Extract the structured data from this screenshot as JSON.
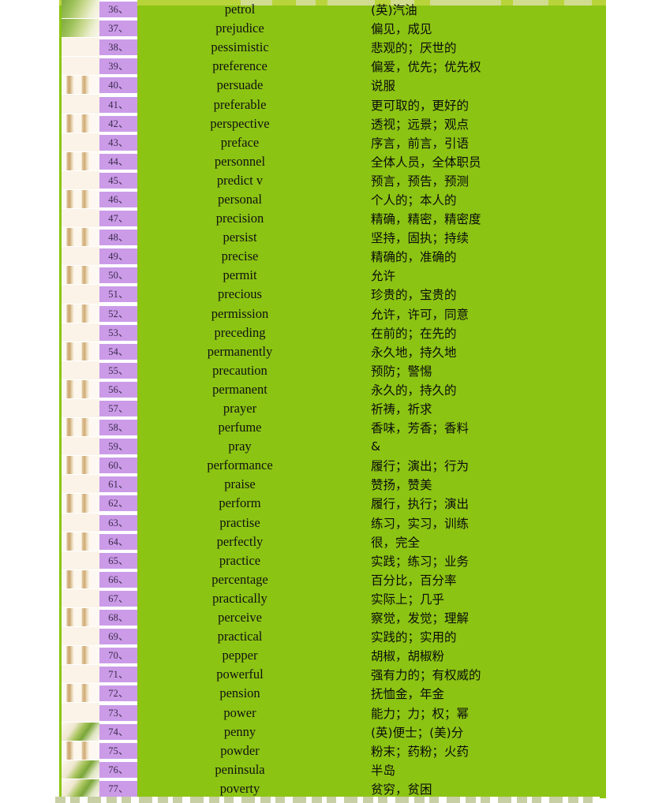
{
  "page": {
    "background_color": "#ffffff",
    "panel_color": "#8cc413",
    "badge_color": "#cb9be8",
    "top_strip_color": "#b9d43a"
  },
  "columns": {
    "index_header": "",
    "word_header": "",
    "translation_header": ""
  },
  "rows": [
    {
      "num": "36、",
      "word": "petrol",
      "trans": "(英)汽油",
      "photo": "leafy"
    },
    {
      "num": "37、",
      "word": "prejudice",
      "trans": "偏见，成见",
      "photo": "leafy"
    },
    {
      "num": "38、",
      "word": "pessimistic",
      "trans": "悲观的；厌世的",
      "photo": "stalk"
    },
    {
      "num": "39、",
      "word": "preference",
      "trans": "偏爱，优先；优先权",
      "photo": "stalk"
    },
    {
      "num": "40、",
      "word": "persuade",
      "trans": "说服",
      "photo": "stalk2"
    },
    {
      "num": "41、",
      "word": "preferable",
      "trans": "更可取的，更好的",
      "photo": "stalk"
    },
    {
      "num": "42、",
      "word": "perspective",
      "trans": "透视；远景；观点",
      "photo": "stalk2"
    },
    {
      "num": "43、",
      "word": "preface",
      "trans": "序言，前言，引语",
      "photo": "stalk"
    },
    {
      "num": "44、",
      "word": "personnel",
      "trans": "全体人员，全体职员",
      "photo": "stalk2"
    },
    {
      "num": "45、",
      "word": "predict v",
      "trans": "预言，预告，预测",
      "photo": "stalk"
    },
    {
      "num": "46、",
      "word": "personal",
      "trans": "个人的；本人的",
      "photo": "stalk2"
    },
    {
      "num": "47、",
      "word": "precision",
      "trans": "精确，精密，精密度",
      "photo": "stalk"
    },
    {
      "num": "48、",
      "word": "persist",
      "trans": "坚持，固执；持续",
      "photo": "stalk2"
    },
    {
      "num": "49、",
      "word": "precise",
      "trans": "精确的，准确的",
      "photo": "stalk"
    },
    {
      "num": "50、",
      "word": "permit",
      "trans": "允许",
      "photo": "stalk2"
    },
    {
      "num": "51、",
      "word": "precious",
      "trans": "珍贵的，宝贵的",
      "photo": "stalk"
    },
    {
      "num": "52、",
      "word": "permission",
      "trans": "允许，许可，同意",
      "photo": "stalk2"
    },
    {
      "num": "53、",
      "word": "preceding",
      "trans": "在前的；在先的",
      "photo": "stalk"
    },
    {
      "num": "54、",
      "word": "permanently",
      "trans": "永久地，持久地",
      "photo": "stalk2"
    },
    {
      "num": "55、",
      "word": "precaution",
      "trans": "预防；警惕",
      "photo": "stalk"
    },
    {
      "num": "56、",
      "word": "permanent",
      "trans": "永久的，持久的",
      "photo": "stalk2"
    },
    {
      "num": "57、",
      "word": "prayer",
      "trans": "祈祷，祈求",
      "photo": "stalk"
    },
    {
      "num": "58、",
      "word": "perfume",
      "trans": "香味，芳香；香料",
      "photo": "stalk2"
    },
    {
      "num": "59、",
      "word": "pray",
      "trans": "&",
      "photo": "stalk"
    },
    {
      "num": "60、",
      "word": "performance",
      "trans": "履行；演出；行为",
      "photo": "stalk2"
    },
    {
      "num": "61、",
      "word": "praise",
      "trans": "赞扬，赞美",
      "photo": "stalk"
    },
    {
      "num": "62、",
      "word": "perform",
      "trans": "履行，执行；演出",
      "photo": "stalk2"
    },
    {
      "num": "63、",
      "word": "practise",
      "trans": "练习，实习，训练",
      "photo": "stalk"
    },
    {
      "num": "64、",
      "word": "perfectly",
      "trans": "很，完全",
      "photo": "stalk2"
    },
    {
      "num": "65、",
      "word": "practice",
      "trans": "实践；练习；业务",
      "photo": "stalk"
    },
    {
      "num": "66、",
      "word": "percentage",
      "trans": "百分比，百分率",
      "photo": "stalk2"
    },
    {
      "num": "67、",
      "word": "practically",
      "trans": "实际上；几乎",
      "photo": "stalk"
    },
    {
      "num": "68、",
      "word": "perceive",
      "trans": "察觉，发觉；理解",
      "photo": "stalk2"
    },
    {
      "num": "69、",
      "word": "practical",
      "trans": "实践的；实用的",
      "photo": "stalk"
    },
    {
      "num": "70、",
      "word": "pepper",
      "trans": "胡椒，胡椒粉",
      "photo": "stalk2"
    },
    {
      "num": "71、",
      "word": "powerful",
      "trans": "强有力的；有权威的",
      "photo": "stalk"
    },
    {
      "num": "72、",
      "word": "pension",
      "trans": "抚恤金，年金",
      "photo": "stalk2"
    },
    {
      "num": "73、",
      "word": "power",
      "trans": "能力；力；权；幂",
      "photo": "stalk"
    },
    {
      "num": "74、",
      "word": "penny",
      "trans": "(英)便士；(美)分",
      "photo": "blades"
    },
    {
      "num": "75、",
      "word": "powder",
      "trans": "粉末；药粉；火药",
      "photo": "stalk2"
    },
    {
      "num": "76、",
      "word": "peninsula",
      "trans": "半岛",
      "photo": "blades"
    },
    {
      "num": "77、",
      "word": "poverty",
      "trans": "贫穷，贫困",
      "photo": "blades"
    }
  ]
}
